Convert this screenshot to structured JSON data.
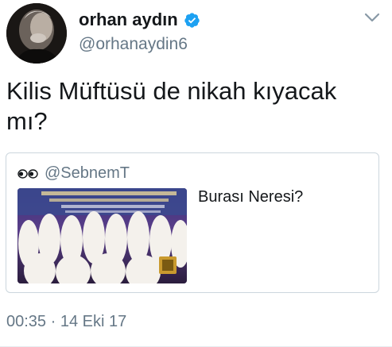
{
  "author": {
    "name": "orhan aydın",
    "handle": "@orhanaydin6",
    "verified": true
  },
  "tweet": {
    "text": "Kilis Müftüsü de nikah kıyacak mı?"
  },
  "quoted_tweet": {
    "prefix_emoji": "eyes-icon",
    "handle": "@SebnemT",
    "text": "Burası Neresi?",
    "media_description": "photo"
  },
  "meta": {
    "timestamp": "00:35 · 14 Eki 17"
  },
  "colors": {
    "text": "#14171a",
    "secondary": "#657786",
    "verified_blue": "#1da1f2",
    "border": "#ccd6dd"
  }
}
